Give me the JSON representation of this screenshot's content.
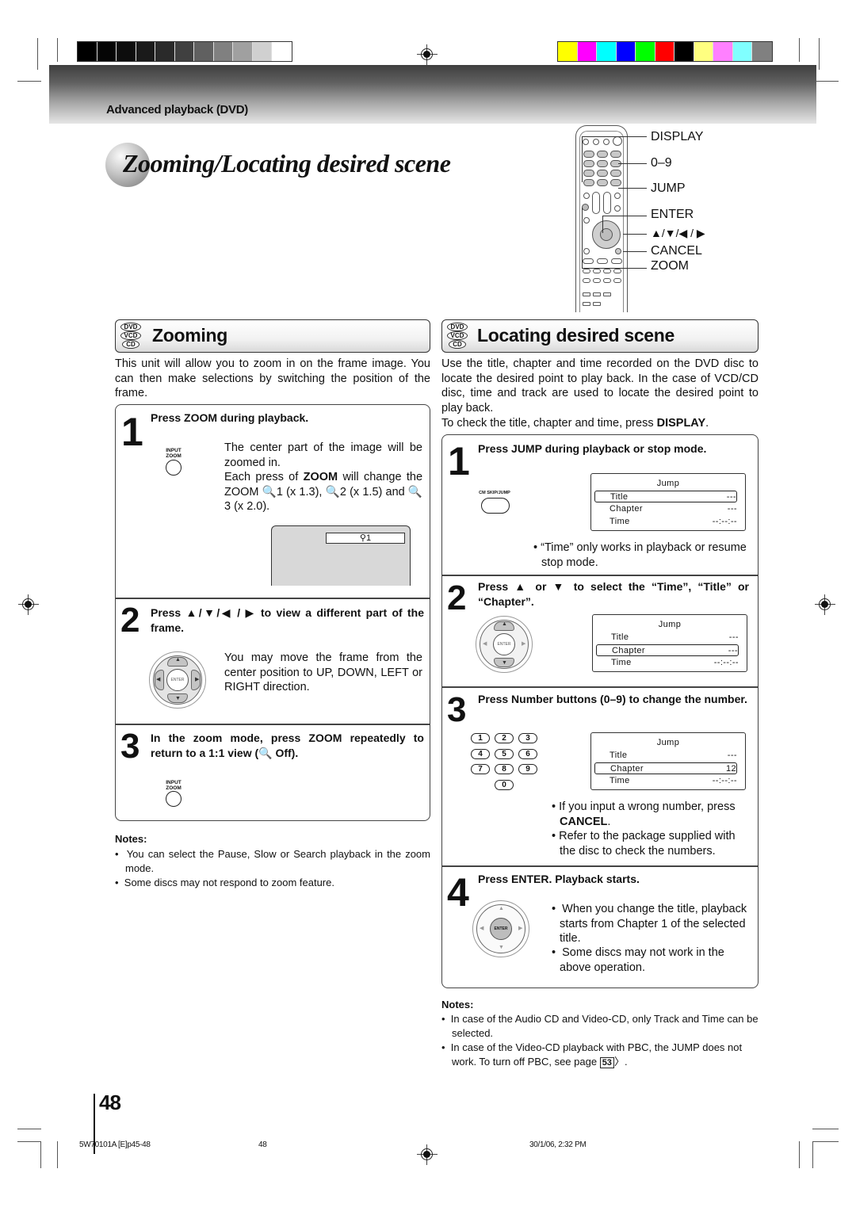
{
  "print_marks": {
    "grayscale_swatches": [
      "#000000",
      "#050505",
      "#0d0d0d",
      "#1a1a1a",
      "#2a2a2a",
      "#404040",
      "#606060",
      "#808080",
      "#a0a0a0",
      "#d0d0d0",
      "#ffffff"
    ],
    "color_swatches": [
      "#ffff00",
      "#ff00ff",
      "#00ffff",
      "#0000ff",
      "#00ff00",
      "#ff0000",
      "#000000",
      "#ffff80",
      "#ff80ff",
      "#80ffff",
      "#808080"
    ]
  },
  "header": {
    "section_label": "Advanced playback (DVD)",
    "page_title": "Zooming/Locating desired scene"
  },
  "remote": {
    "labels": [
      "DISPLAY",
      "0–9",
      "JUMP",
      "ENTER",
      "▲/▼/◀ / ▶",
      "CANCEL",
      "ZOOM"
    ]
  },
  "disc_badges": [
    "DVD",
    "VCD",
    "CD"
  ],
  "zooming": {
    "title": "Zooming",
    "intro": "This unit will allow you to zoom in on the frame image. You can then make selections by switching the position of the frame.",
    "steps": [
      {
        "number": "1",
        "heading": "Press ZOOM during playback.",
        "button_label": "INPUT ZOOM",
        "text_a": "The center part of the image will be zoomed in.",
        "text_b_pre": "Each press of ",
        "text_b_bold": "ZOOM",
        "text_b_post": " will change the ZOOM 🔍1 (x 1.3), 🔍2 (x 1.5) and 🔍3 (x 2.0).",
        "screen_indicator": "1"
      },
      {
        "number": "2",
        "heading": "Press ▲/▼/◀ / ▶ to view a different part of the frame.",
        "text": "You may move the frame from the center position to UP, DOWN, LEFT or RIGHT direction.",
        "dpad_center": "ENTER"
      },
      {
        "number": "3",
        "heading": "In the zoom mode, press ZOOM repeatedly to return to a 1:1 view (🔍 Off).",
        "button_label": "INPUT ZOOM"
      }
    ],
    "notes_title": "Notes:",
    "notes": [
      "You can select the Pause, Slow or Search playback in the zoom mode.",
      "Some discs may not respond to zoom feature."
    ]
  },
  "locating": {
    "title": "Locating desired scene",
    "intro": "Use the title, chapter and time recorded on the DVD disc to locate the desired point to play back. In the case of VCD/CD disc, time and track are used to locate the desired point to play back.",
    "intro2_pre": "To check the title, chapter and time, press ",
    "intro2_bold": "DISPLAY",
    "intro2_post": ".",
    "steps": [
      {
        "number": "1",
        "heading": "Press JUMP during playback or stop mode.",
        "button_label": "CM SKIP/JUMP",
        "menu": {
          "title": "Jump",
          "rows": [
            {
              "label": "Title",
              "value": "---"
            },
            {
              "label": "Chapter",
              "value": "---"
            },
            {
              "label": "Time",
              "value": "--:--:--"
            }
          ],
          "selected": "Title"
        },
        "bullets": [
          "“Time” only works in playback or resume stop mode."
        ]
      },
      {
        "number": "2",
        "heading": "Press ▲ or ▼ to select the “Time”, “Title” or “Chapter”.",
        "dpad_center": "ENTER",
        "menu": {
          "title": "Jump",
          "rows": [
            {
              "label": "Title",
              "value": "---"
            },
            {
              "label": "Chapter",
              "value": "---"
            },
            {
              "label": "Time",
              "value": "--:--:--"
            }
          ],
          "selected": "Chapter"
        }
      },
      {
        "number": "3",
        "heading": "Press Number buttons (0–9) to change the number.",
        "number_keys": [
          "1",
          "2",
          "3",
          "4",
          "5",
          "6",
          "7",
          "8",
          "9",
          "0"
        ],
        "menu": {
          "title": "Jump",
          "rows": [
            {
              "label": "Title",
              "value": "---"
            },
            {
              "label": "Chapter",
              "value": "12"
            },
            {
              "label": "Time",
              "value": "--:--:--"
            }
          ],
          "selected": "Chapter"
        },
        "bullet1_pre": "If you input a wrong number, press ",
        "bullet1_bold": "CANCEL",
        "bullet1_post": ".",
        "bullet2": "Refer to the package supplied with the disc to check the numbers."
      },
      {
        "number": "4",
        "heading": "Press ENTER. Playback starts.",
        "dpad_center": "ENTER",
        "bullets": [
          "When you change the title, playback starts from Chapter 1 of the selected title.",
          "Some discs may not work in the above operation."
        ]
      }
    ],
    "notes_title": "Notes:",
    "notes": [
      "In case of the Audio CD and Video-CD, only Track and Time can be selected."
    ],
    "note2_pre": "In case of the Video-CD playback with PBC, the JUMP does not work. To turn off PBC, see page ",
    "note2_ref": "53",
    "note2_post": "〉."
  },
  "footer": {
    "page_number": "48",
    "file_code": "5W70101A [E]p45-48",
    "footer_page": "48",
    "timestamp": "30/1/06, 2:32 PM"
  }
}
